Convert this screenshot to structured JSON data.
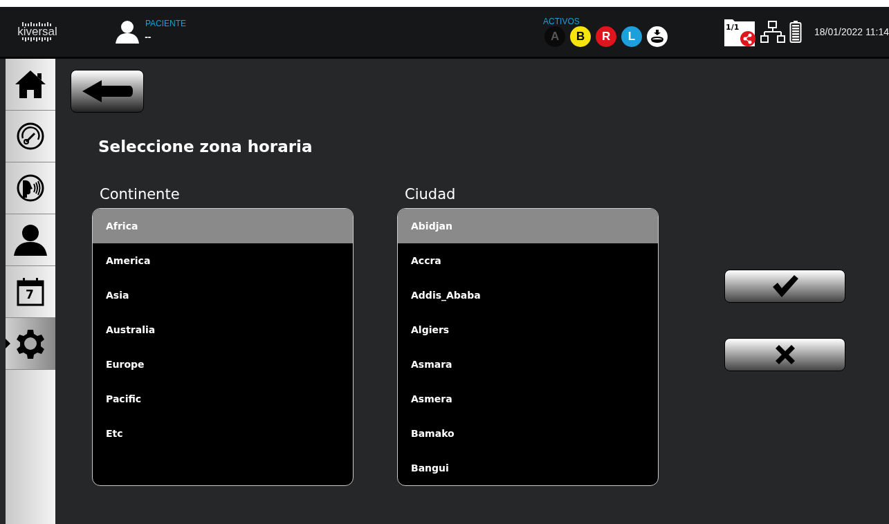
{
  "header": {
    "logo": "kiversal",
    "patient_label": "PACIENTE",
    "patient_value": "--",
    "activos_label": "ACTIVOS",
    "activos": [
      {
        "letter": "A",
        "color": "#0a0a0a"
      },
      {
        "letter": "B",
        "color": "#f5e50a"
      },
      {
        "letter": "R",
        "color": "#e0141c"
      },
      {
        "letter": "L",
        "color": "#1ca0dc"
      }
    ],
    "folder_count": "1/1",
    "datetime": "18/01/2022 11:14"
  },
  "sidebar": {
    "items": [
      {
        "kind": "home",
        "selected": false
      },
      {
        "kind": "gauge",
        "selected": false
      },
      {
        "kind": "speech",
        "selected": false
      },
      {
        "kind": "person",
        "selected": false
      },
      {
        "kind": "calendar",
        "selected": false,
        "text": "7"
      },
      {
        "kind": "settings",
        "selected": true
      }
    ]
  },
  "title": "Seleccione zona horaria",
  "lists": [
    {
      "label": "Continente",
      "items": [
        {
          "text": "Africa",
          "selected": true
        },
        {
          "text": "America",
          "selected": false
        },
        {
          "text": "Asia",
          "selected": false
        },
        {
          "text": "Australia",
          "selected": false
        },
        {
          "text": "Europe",
          "selected": false
        },
        {
          "text": "Pacific",
          "selected": false
        },
        {
          "text": "Etc",
          "selected": false
        }
      ]
    },
    {
      "label": "Ciudad",
      "items": [
        {
          "text": "Abidjan",
          "selected": true
        },
        {
          "text": "Accra",
          "selected": false
        },
        {
          "text": "Addis_Ababa",
          "selected": false
        },
        {
          "text": "Algiers",
          "selected": false
        },
        {
          "text": "Asmara",
          "selected": false
        },
        {
          "text": "Asmera",
          "selected": false
        },
        {
          "text": "Bamako",
          "selected": false
        },
        {
          "text": "Bangui",
          "selected": false
        }
      ]
    }
  ]
}
